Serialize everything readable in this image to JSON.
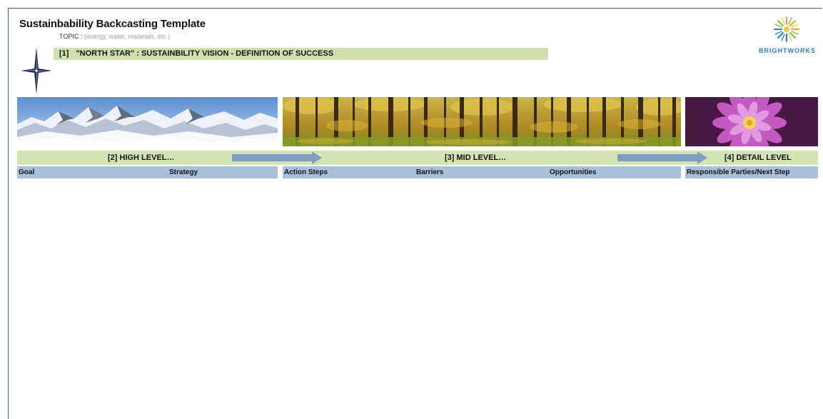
{
  "document": {
    "title": "Sustainbability Backcasting Template",
    "topic_label": "TOPIC :",
    "topic_hint": "(energy, water, materials, etc.)",
    "vision_number": "[1]",
    "vision_text": "\"NORTH STAR\" : SUSTAINBILITY VISION - DEFINITION OF SUCCESS"
  },
  "logo": {
    "text": "BRIGHTWORKS",
    "icon": "sunburst-logo-icon"
  },
  "star_icon": "compass-star-icon",
  "photos": [
    "mountains-photo",
    "forest-photo",
    "flower-photo"
  ],
  "levels": {
    "high": "[2] HIGH LEVEL…",
    "mid": "[3] MID LEVEL…",
    "detail": "[4] DETAIL LEVEL"
  },
  "columns": {
    "goal": "Goal",
    "strategy": "Strategy",
    "action_steps": "Action Steps",
    "barriers": "Barriers",
    "opportunities": "Opportunities",
    "responsible": "Responsible Parties/Next Step"
  },
  "colors": {
    "vision_bar": "#cfe0ad",
    "level_bar": "#d3e3b3",
    "column_header": "#a9c0db",
    "arrow": "#7f9ebf",
    "logo_text": "#2f7dbf"
  }
}
